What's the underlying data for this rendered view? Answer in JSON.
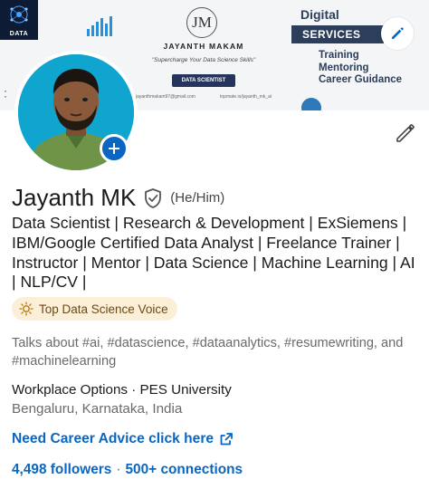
{
  "banner": {
    "logo_label": "DATA",
    "brand_monogram": "JM",
    "brand_name": "JAYANTH MAKAM",
    "brand_tagline": "\"Supercharge Your Data Science Skills\"",
    "brand_role": "DATA SCIENTIST",
    "contact_email": "jayanthmakam97@gmail.com",
    "contact_url": "topmate.io/jayanth_mk_ai",
    "digital_label": "Digital",
    "services_label": "SERVICES",
    "services": [
      "Training",
      "Mentoring",
      "Career Guidance"
    ]
  },
  "profile": {
    "name": "Jayanth MK",
    "pronouns": "(He/Him)",
    "headline": "Data Scientist | Research & Development | ExSiemens | IBM/Google Certified Data Analyst | Freelance Trainer | Instructor | Mentor | Data Science | Machine Learning | AI | NLP/CV |",
    "badge": "Top Data Science Voice",
    "talks_about": "Talks about #ai, #datascience, #dataanalytics, #resumewriting, and #machinelearning",
    "workplace": "Workplace Options · PES University",
    "location": "Bengaluru, Karnataka, India",
    "link_label": "Need Career Advice click here",
    "followers": "4,498 followers",
    "separator": "·",
    "connections": "500+ connections"
  },
  "colors": {
    "accent": "#0a66c2",
    "avatar_bg": "#10a5cf",
    "badge_bg": "#fcefd8",
    "banner_navy": "#2d3e5b"
  },
  "icons": {
    "banner_edit": "pencil-icon",
    "profile_edit": "pencil-icon",
    "add_photo": "plus-icon",
    "verified": "shield-check-icon",
    "badge": "lightbulb-icon",
    "external_link": "external-link-icon"
  }
}
